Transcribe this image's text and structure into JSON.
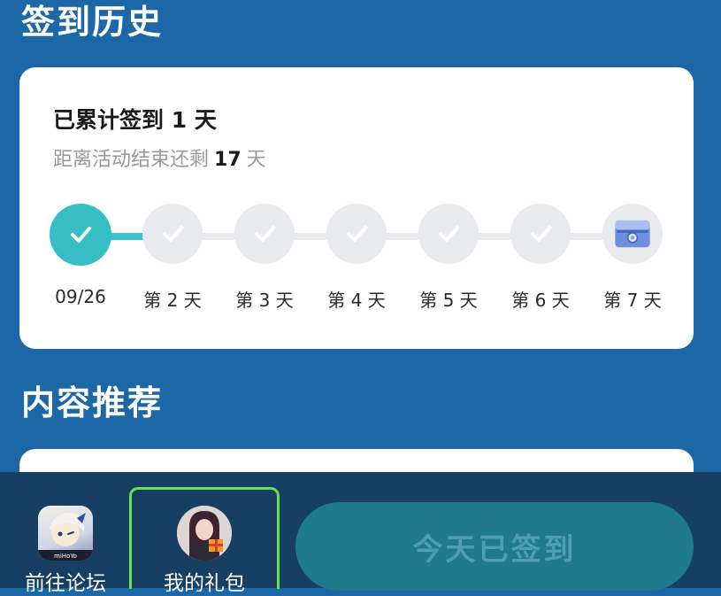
{
  "history": {
    "title": "签到历史",
    "total_label_prefix": "已累计签到",
    "total_days": "1",
    "total_label_suffix": "天",
    "remaining_prefix": "距离活动结束还剩",
    "remaining_days": "17",
    "remaining_suffix": "天",
    "days": [
      {
        "label": "09/26",
        "status": "checked"
      },
      {
        "label": "第 2 天",
        "status": "pending"
      },
      {
        "label": "第 3 天",
        "status": "pending"
      },
      {
        "label": "第 4 天",
        "status": "pending"
      },
      {
        "label": "第 5 天",
        "status": "pending"
      },
      {
        "label": "第 6 天",
        "status": "pending"
      },
      {
        "label": "第 7 天",
        "status": "reward"
      }
    ]
  },
  "recommend": {
    "title": "内容推荐"
  },
  "bottom_bar": {
    "forum_label": "前往论坛",
    "gift_label": "我的礼包",
    "checkin_button": "今天已签到"
  },
  "colors": {
    "background": "#1c68a6",
    "accent": "#36bec4",
    "pending_step": "#e8eaed",
    "bottom_bar": "#163f63",
    "selected_outline": "#6be04b"
  }
}
